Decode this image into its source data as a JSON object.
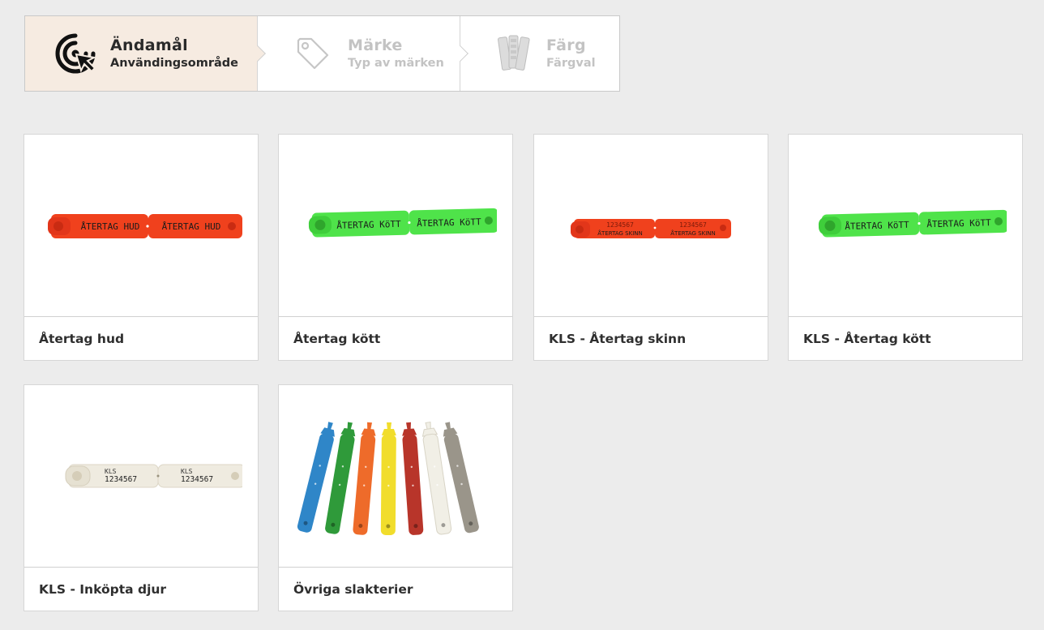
{
  "stepper": {
    "steps": [
      {
        "title": "Ändamål",
        "subtitle": "Användingsområde",
        "icon": "target-cursor-icon",
        "state": "active"
      },
      {
        "title": "Märke",
        "subtitle": "Typ av märken",
        "icon": "tag-icon",
        "state": "inactive"
      },
      {
        "title": "Färg",
        "subtitle": "Färgval",
        "icon": "color-swatch-icon",
        "state": "inactive"
      }
    ]
  },
  "products": [
    {
      "name": "Återtag hud",
      "tag_text": "ÅTERTAG HUD",
      "tag_color": "#f0411d"
    },
    {
      "name": "Återtag kött",
      "tag_text": "ÅTERTAG KöTT",
      "tag_color": "#4fe34a"
    },
    {
      "name": "KLS - Återtag skinn",
      "tag_number": "1234567",
      "tag_text": "ÅTERTAG SKINN",
      "tag_color": "#f0411d"
    },
    {
      "name": "KLS - Återtag kött",
      "tag_text": "ÅTERTAG KöTT",
      "tag_color": "#4fe34a"
    },
    {
      "name": "KLS - Inköpta djur",
      "tag_prefix": "KLS",
      "tag_number": "1234567",
      "tag_color": "#efebe0"
    },
    {
      "name": "Övriga slakterier",
      "strap_colors": [
        "#2f86c8",
        "#2f9a3a",
        "#ee6b2a",
        "#f1dd2c",
        "#b8352a",
        "#f1efe6",
        "#9a958a"
      ]
    }
  ]
}
